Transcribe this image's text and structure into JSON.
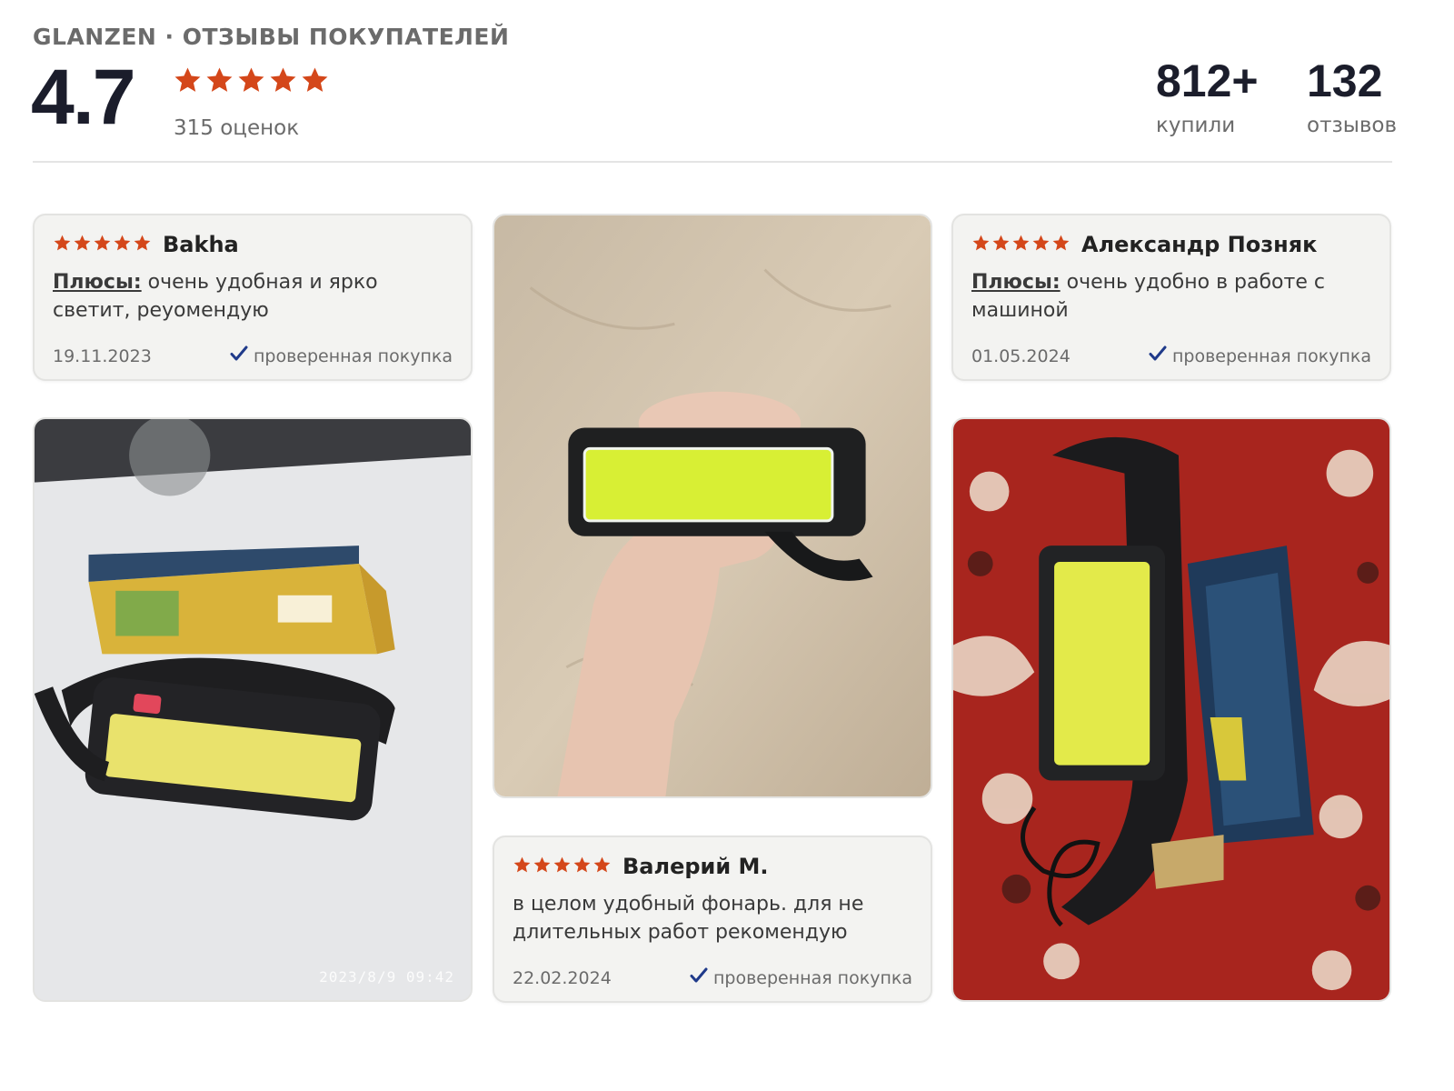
{
  "header": {
    "title": "GLANZEN · ОТЗЫВЫ ПОКУПАТЕЛЕЙ",
    "rating": "4.7",
    "stars": 5,
    "ratings_count": "315 оценок"
  },
  "stats": [
    {
      "value": "812+",
      "label": "купили"
    },
    {
      "value": "132",
      "label": "отзывов"
    }
  ],
  "colors": {
    "star": "#d4471a",
    "check": "#1f3a8a",
    "card_bg": "#f3f3f1",
    "heading": "#1b1d2b",
    "muted": "#6b6b6b"
  },
  "reviews": [
    {
      "author": "Bakha",
      "stars": 5,
      "pros_label": "Плюсы:",
      "text": " очень удобная и ярко светит, реуомендую",
      "date": "19.11.2023",
      "verified": "проверенная покупка"
    },
    {
      "author": "Александр Позняк",
      "stars": 5,
      "pros_label": "Плюсы:",
      "text": " очень удобно в работе с машиной",
      "date": "01.05.2024",
      "verified": "проверенная покупка"
    },
    {
      "author": "Валерий М.",
      "stars": 5,
      "pros_label": "",
      "text": "в целом удобный фонарь. для не длительных работ рекомендую",
      "date": "22.02.2024",
      "verified": "проверенная покупка"
    }
  ],
  "photos": [
    {
      "icon": "headlamp-box-photo",
      "timestamp": "2023/8/9  09:42"
    },
    {
      "icon": "hand-holding-headlamp-photo",
      "timestamp": ""
    },
    {
      "icon": "headlamp-on-carpet-photo",
      "timestamp": ""
    }
  ]
}
